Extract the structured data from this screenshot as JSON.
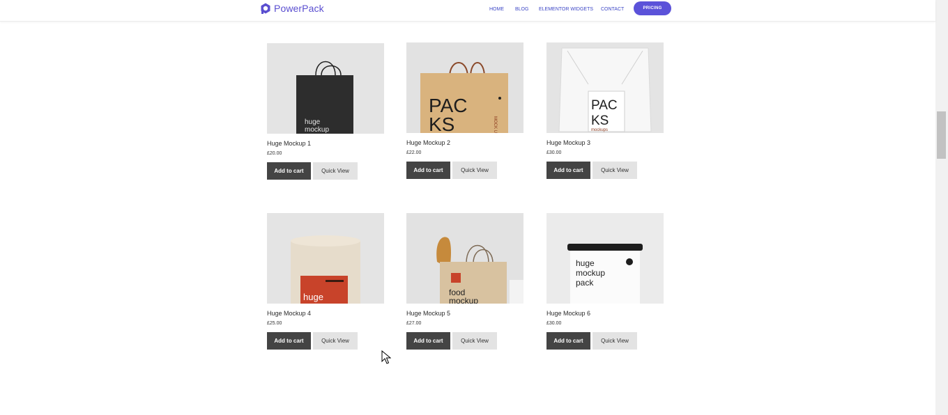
{
  "brand": {
    "name": "PowerPack",
    "logo_icon": "powerpack-logo-icon",
    "accent": "#5b52d9"
  },
  "nav": [
    {
      "label": "HOME"
    },
    {
      "label": "BLOG"
    },
    {
      "label": "ELEMENTOR WIDGETS"
    },
    {
      "label": "CONTACT"
    }
  ],
  "pricing_label": "PRICING",
  "buttons": {
    "add_to_cart": "Add to cart",
    "quick_view": "Quick View"
  },
  "products": [
    {
      "name": "Huge Mockup 1",
      "price": "£20.00",
      "image_text": "huge\nmockup",
      "image": "black-shopping-bag"
    },
    {
      "name": "Huge Mockup 2",
      "price": "£22.00",
      "image_text": "PAC\nKS",
      "image_side_text": "MOCK UPS",
      "image": "kraft-paper-bag"
    },
    {
      "name": "Huge Mockup 3",
      "price": "£30.00",
      "image_text": "PAC\nKS",
      "image_sub_text": "mockups",
      "image": "white-drawstring-bag"
    },
    {
      "name": "Huge Mockup 4",
      "price": "£25.00",
      "image_text": "huge\nmockup",
      "image": "kraft-tube"
    },
    {
      "name": "Huge Mockup 5",
      "price": "£27.00",
      "image_text": "food\nmockup",
      "image": "bread-paper-bag"
    },
    {
      "name": "Huge Mockup 6",
      "price": "£30.00",
      "image_text": "huge\nmockup\npack",
      "image": "white-tin-box"
    }
  ]
}
